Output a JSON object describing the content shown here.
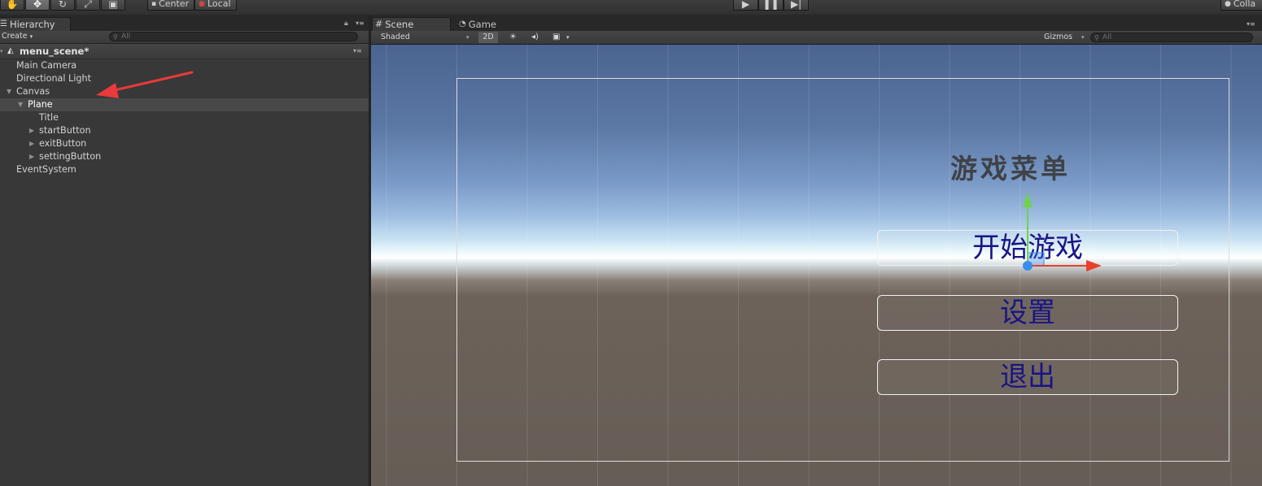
{
  "toolbar": {
    "tools": [
      "hand-icon",
      "move-icon",
      "rotate-icon",
      "scale-icon",
      "rect-icon"
    ],
    "pivot_label": "Center",
    "space_label": "Local",
    "collab_label": "Colla"
  },
  "hierarchy": {
    "tab_label": "Hierarchy",
    "create_label": "Create",
    "search_placeholder": "All",
    "scene_name": "menu_scene*",
    "items": [
      {
        "label": "Main Camera"
      },
      {
        "label": "Directional Light"
      },
      {
        "label": "Canvas"
      },
      {
        "label": "Plane"
      },
      {
        "label": "Title"
      },
      {
        "label": "startButton"
      },
      {
        "label": "exitButton"
      },
      {
        "label": "settingButton"
      },
      {
        "label": "EventSystem"
      }
    ]
  },
  "scene": {
    "scene_tab": "Scene",
    "game_tab": "Game",
    "shading_mode": "Shaded",
    "mode_2d": "2D",
    "gizmos_label": "Gizmos",
    "search_placeholder": "All",
    "ui": {
      "title": "游戏菜单",
      "start_button": "开始游戏",
      "settings_button": "设置",
      "exit_button": "退出"
    }
  },
  "colors": {
    "annotation_arrow": "#e83a3a",
    "button_text": "#1a1484",
    "gizmo_x": "#e8402a",
    "gizmo_y": "#6fd24c",
    "gizmo_center": "#3a8cf0"
  }
}
